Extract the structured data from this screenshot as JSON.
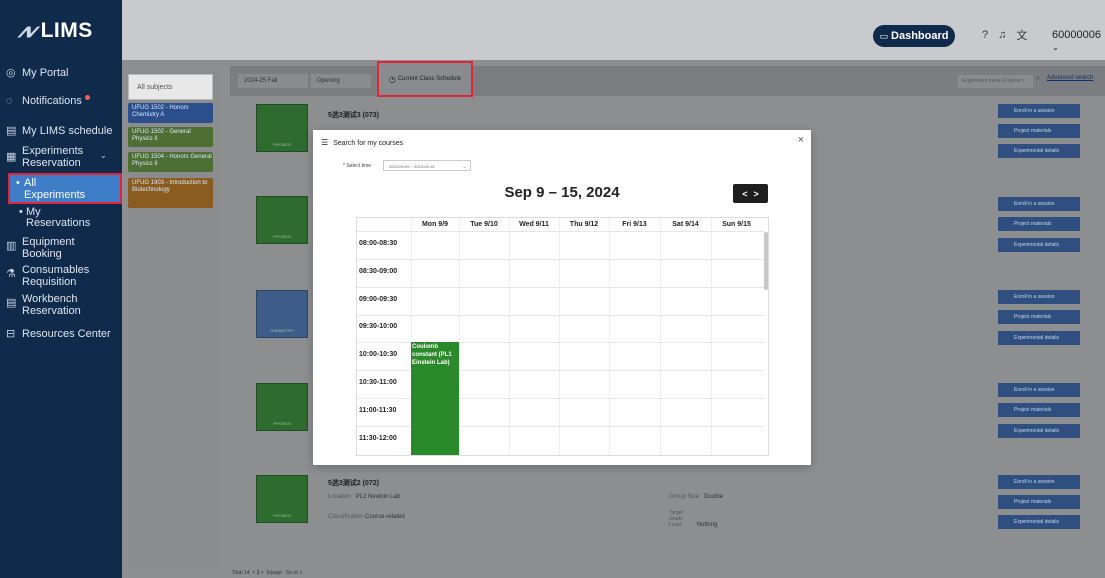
{
  "app": {
    "logo_text": "LIMS",
    "logo_mark": "⩘⩗"
  },
  "sidebar": {
    "items": [
      {
        "label": "My Portal",
        "icon": "portal-icon"
      },
      {
        "label": "Notifications",
        "icon": "chat-icon",
        "badge": true
      },
      {
        "label": "My LIMS schedule",
        "icon": "calendar-icon"
      },
      {
        "label": "Experiments Reservation",
        "icon": "flask-icon",
        "expanded": true
      },
      {
        "label": "Equipment Booking",
        "icon": "equipment-icon"
      },
      {
        "label": "Consumables Requisition",
        "icon": "consumables-icon"
      },
      {
        "label": "Workbench Reservation",
        "icon": "workbench-icon"
      },
      {
        "label": "Resources Center",
        "icon": "resources-icon"
      }
    ],
    "sub_items": [
      {
        "label": "All Experiments",
        "active": true
      },
      {
        "label": "My Reservations",
        "active": false
      }
    ]
  },
  "header": {
    "dashboard_label": "Dashboard",
    "user_id": "60000006"
  },
  "subjects": {
    "all_label": "All subjects",
    "tags": [
      {
        "label": "UFUG 1502 - Honors Chemistry A",
        "color": "#2b4f8c"
      },
      {
        "label": "UFUG 1502 - General Physics II",
        "color": "#4d6f33"
      },
      {
        "label": "UFUG 1504 - Honors General Physics II",
        "color": "#4d6f33"
      },
      {
        "label": "UFUG 1903 - Introduction to Biotechnology",
        "color": "#8a5c1f"
      }
    ]
  },
  "filters": {
    "semester": "2024-25 Fall",
    "status": "Opening",
    "schedule_label": "Current Class Schedule",
    "search_placeholder": "Experiment name (Course c",
    "advanced_label": "Advanced search"
  },
  "cards": [
    {
      "title": "5选3测试3 (073)",
      "thumb": "PHYSICS"
    },
    {
      "title": "",
      "thumb": "PHYSICS"
    },
    {
      "title": "",
      "thumb": "CHEMISTRY"
    },
    {
      "title": "",
      "thumb": "PHYSICS"
    },
    {
      "title": "5选3测试2 (072)",
      "thumb": "PHYSICS",
      "location_label": "Location",
      "location": "PL2 Newton Lab",
      "class_label": "Classification",
      "class_value": "Course-related",
      "group_label": "Group Size",
      "group_value": "Double",
      "target_label": "Target Grade Level",
      "target_value": "Nothing"
    }
  ],
  "card_actions": [
    "Enroll in a session",
    "Project materials",
    "Experimental details"
  ],
  "pager": {
    "total": "Total 14",
    "page": "1",
    "per_page": "5/page",
    "goto": "Go to",
    "goto_page": "1"
  },
  "modal": {
    "title": "Search for my courses",
    "select_label": "* Select time",
    "select_value": "2024-09-09 ~ 2024-09-15",
    "week_title": "Sep 9 – 15, 2024",
    "days": [
      "Mon 9/9",
      "Tue 9/10",
      "Wed 9/11",
      "Thu 9/12",
      "Fri 9/13",
      "Sat 9/14",
      "Sun 9/15"
    ],
    "times": [
      "08:00-08:30",
      "08:30-09:00",
      "09:00-09:30",
      "09:30-10:00",
      "10:00-10:30",
      "10:30-11:00",
      "11:00-11:30",
      "11:30-12:00"
    ],
    "event": {
      "text": "Coulomb constant (PL1 Einstein Lab)",
      "day": "Mon 9/9",
      "start": "10:00",
      "color": "#2a8a2a"
    }
  },
  "colors": {
    "sidebar_bg": "#0f2a4a",
    "accent": "#3f7cc8",
    "highlight": "#e0243a",
    "event_green": "#2a8a2a"
  }
}
